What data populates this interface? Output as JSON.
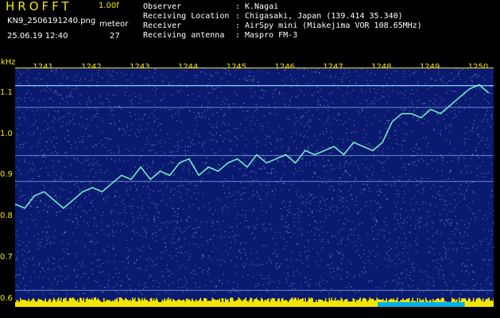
{
  "header": {
    "app_title": "HROFFT",
    "version": "1.00f",
    "file_name": "KN9_2506191240.png",
    "datetime": "25.06.19 12:40",
    "meteor_label": "meteor",
    "meteor_count": "27",
    "info": [
      {
        "label": "Observer",
        "value": "K.Nagai"
      },
      {
        "label": "Receiving Location",
        "value": "Chigasaki, Japan (139.414 35.340)"
      },
      {
        "label": "Receiver",
        "value": "AirSpy mini (Miakejima VOR 108.65MHz)"
      },
      {
        "label": "Receiving antenna",
        "value": "Maspro FM-3"
      }
    ]
  },
  "colors": {
    "label": "#f2e600",
    "text": "#ffffff",
    "background": "#0a1a70",
    "signal_bar": "#f2e600",
    "signal_bar_low": "#00b4e6"
  },
  "chart_data": {
    "type": "heatmap",
    "ylabel": "kHz",
    "x_ticks": [
      "1241",
      "1242",
      "1243",
      "1244",
      "1245",
      "1246",
      "1247",
      "1248",
      "1249",
      "1250"
    ],
    "y_ticks": [
      "1.1",
      "1.0",
      "0.9",
      "0.8",
      "0.7",
      "0.6"
    ],
    "ylim": [
      0.58,
      1.16
    ],
    "xlim": [
      1240.4,
      1250.3
    ],
    "carrier_lines_khz": [
      1.118,
      1.065,
      0.948,
      0.885,
      0.62
    ],
    "trace": {
      "x": [
        1240.4,
        1240.6,
        1240.8,
        1241.0,
        1241.2,
        1241.4,
        1241.6,
        1241.8,
        1242.0,
        1242.2,
        1242.4,
        1242.6,
        1242.8,
        1243.0,
        1243.2,
        1243.4,
        1243.6,
        1243.8,
        1244.0,
        1244.2,
        1244.4,
        1244.6,
        1244.8,
        1245.0,
        1245.2,
        1245.4,
        1245.6,
        1245.8,
        1246.0,
        1246.2,
        1246.4,
        1246.6,
        1246.8,
        1247.0,
        1247.2,
        1247.4,
        1247.6,
        1247.8,
        1248.0,
        1248.2,
        1248.4,
        1248.6,
        1248.8,
        1249.0,
        1249.2,
        1249.4,
        1249.6,
        1249.8,
        1250.0,
        1250.2
      ],
      "y": [
        0.83,
        0.82,
        0.85,
        0.86,
        0.84,
        0.82,
        0.84,
        0.86,
        0.87,
        0.86,
        0.88,
        0.9,
        0.89,
        0.92,
        0.89,
        0.91,
        0.9,
        0.93,
        0.94,
        0.9,
        0.92,
        0.91,
        0.93,
        0.94,
        0.92,
        0.95,
        0.93,
        0.94,
        0.95,
        0.93,
        0.96,
        0.95,
        0.96,
        0.97,
        0.95,
        0.98,
        0.97,
        0.96,
        0.98,
        1.03,
        1.05,
        1.05,
        1.04,
        1.06,
        1.05,
        1.07,
        1.09,
        1.11,
        1.12,
        1.1
      ]
    }
  }
}
